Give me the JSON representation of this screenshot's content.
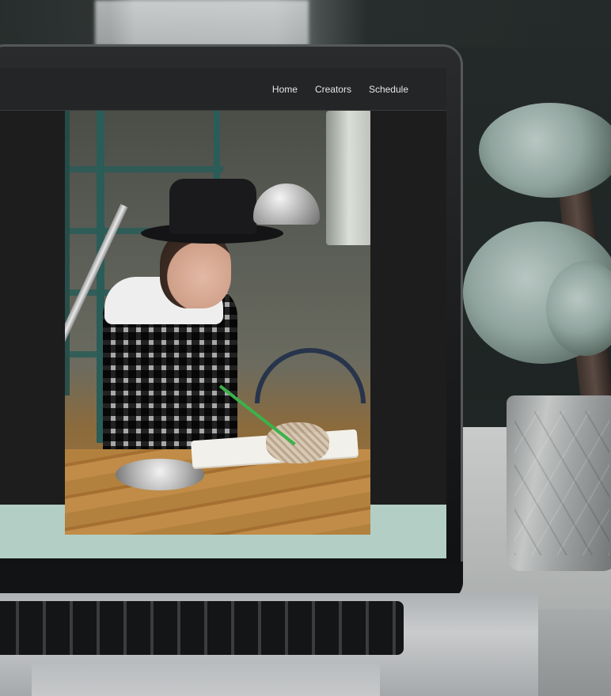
{
  "site": {
    "nav": {
      "items": [
        {
          "label": "Home"
        },
        {
          "label": "Creators"
        },
        {
          "label": "Schedule"
        }
      ]
    }
  },
  "icons": {
    "laptop": "laptop-icon",
    "plant": "plant-icon"
  },
  "colors": {
    "page_background": "#1d1d1e",
    "topbar_background": "#242526",
    "accent_band": "#b3cec4"
  }
}
